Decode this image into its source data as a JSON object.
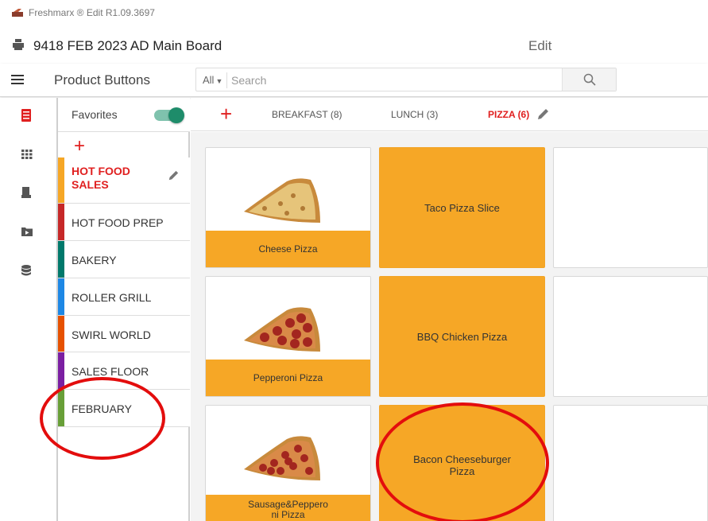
{
  "app": {
    "title_bar": "Freshmarx ® Edit R1.09.3697",
    "board_title": "9418 FEB 2023 AD Main Board",
    "mode": "Edit"
  },
  "toolbar": {
    "title": "Product Buttons",
    "scope": "All",
    "search_placeholder": "Search"
  },
  "categories": {
    "favorites_label": "Favorites",
    "favorites_on": true,
    "items": [
      {
        "label": "HOT FOOD SALES",
        "color": "#f6a726",
        "active": true
      },
      {
        "label": "HOT FOOD PREP",
        "color": "#c62828"
      },
      {
        "label": "BAKERY",
        "color": "#00796b"
      },
      {
        "label": "ROLLER GRILL",
        "color": "#1e88e5"
      },
      {
        "label": "SWIRL WORLD",
        "color": "#e65100"
      },
      {
        "label": "SALES FLOOR",
        "color": "#7b1fa2"
      },
      {
        "label": "FEBRUARY",
        "color": "#689f38"
      }
    ]
  },
  "tabs": [
    {
      "label": "BREAKFAST",
      "count": "(8)"
    },
    {
      "label": "LUNCH",
      "count": "(3)"
    },
    {
      "label": "PIZZA",
      "count": "(6)",
      "active": true
    }
  ],
  "products": [
    {
      "label": "Cheese Pizza",
      "image": "cheese-pizza-slice"
    },
    {
      "label": "Taco Pizza Slice"
    },
    {
      "label": ""
    },
    {
      "label": "Pepperoni Pizza",
      "image": "pepperoni-pizza-slice"
    },
    {
      "label": "BBQ Chicken Pizza"
    },
    {
      "label": ""
    },
    {
      "label": "Sausage&Peppero\nni Pizza",
      "image": "sausage-pepperoni-pizza-slice"
    },
    {
      "label": "Bacon Cheeseburger\nPizza"
    },
    {
      "label": ""
    }
  ],
  "colors": {
    "accent": "#e02020",
    "tile": "#f6a726",
    "toggle": "#1e8c6a",
    "annotation": "#e30d0d"
  }
}
